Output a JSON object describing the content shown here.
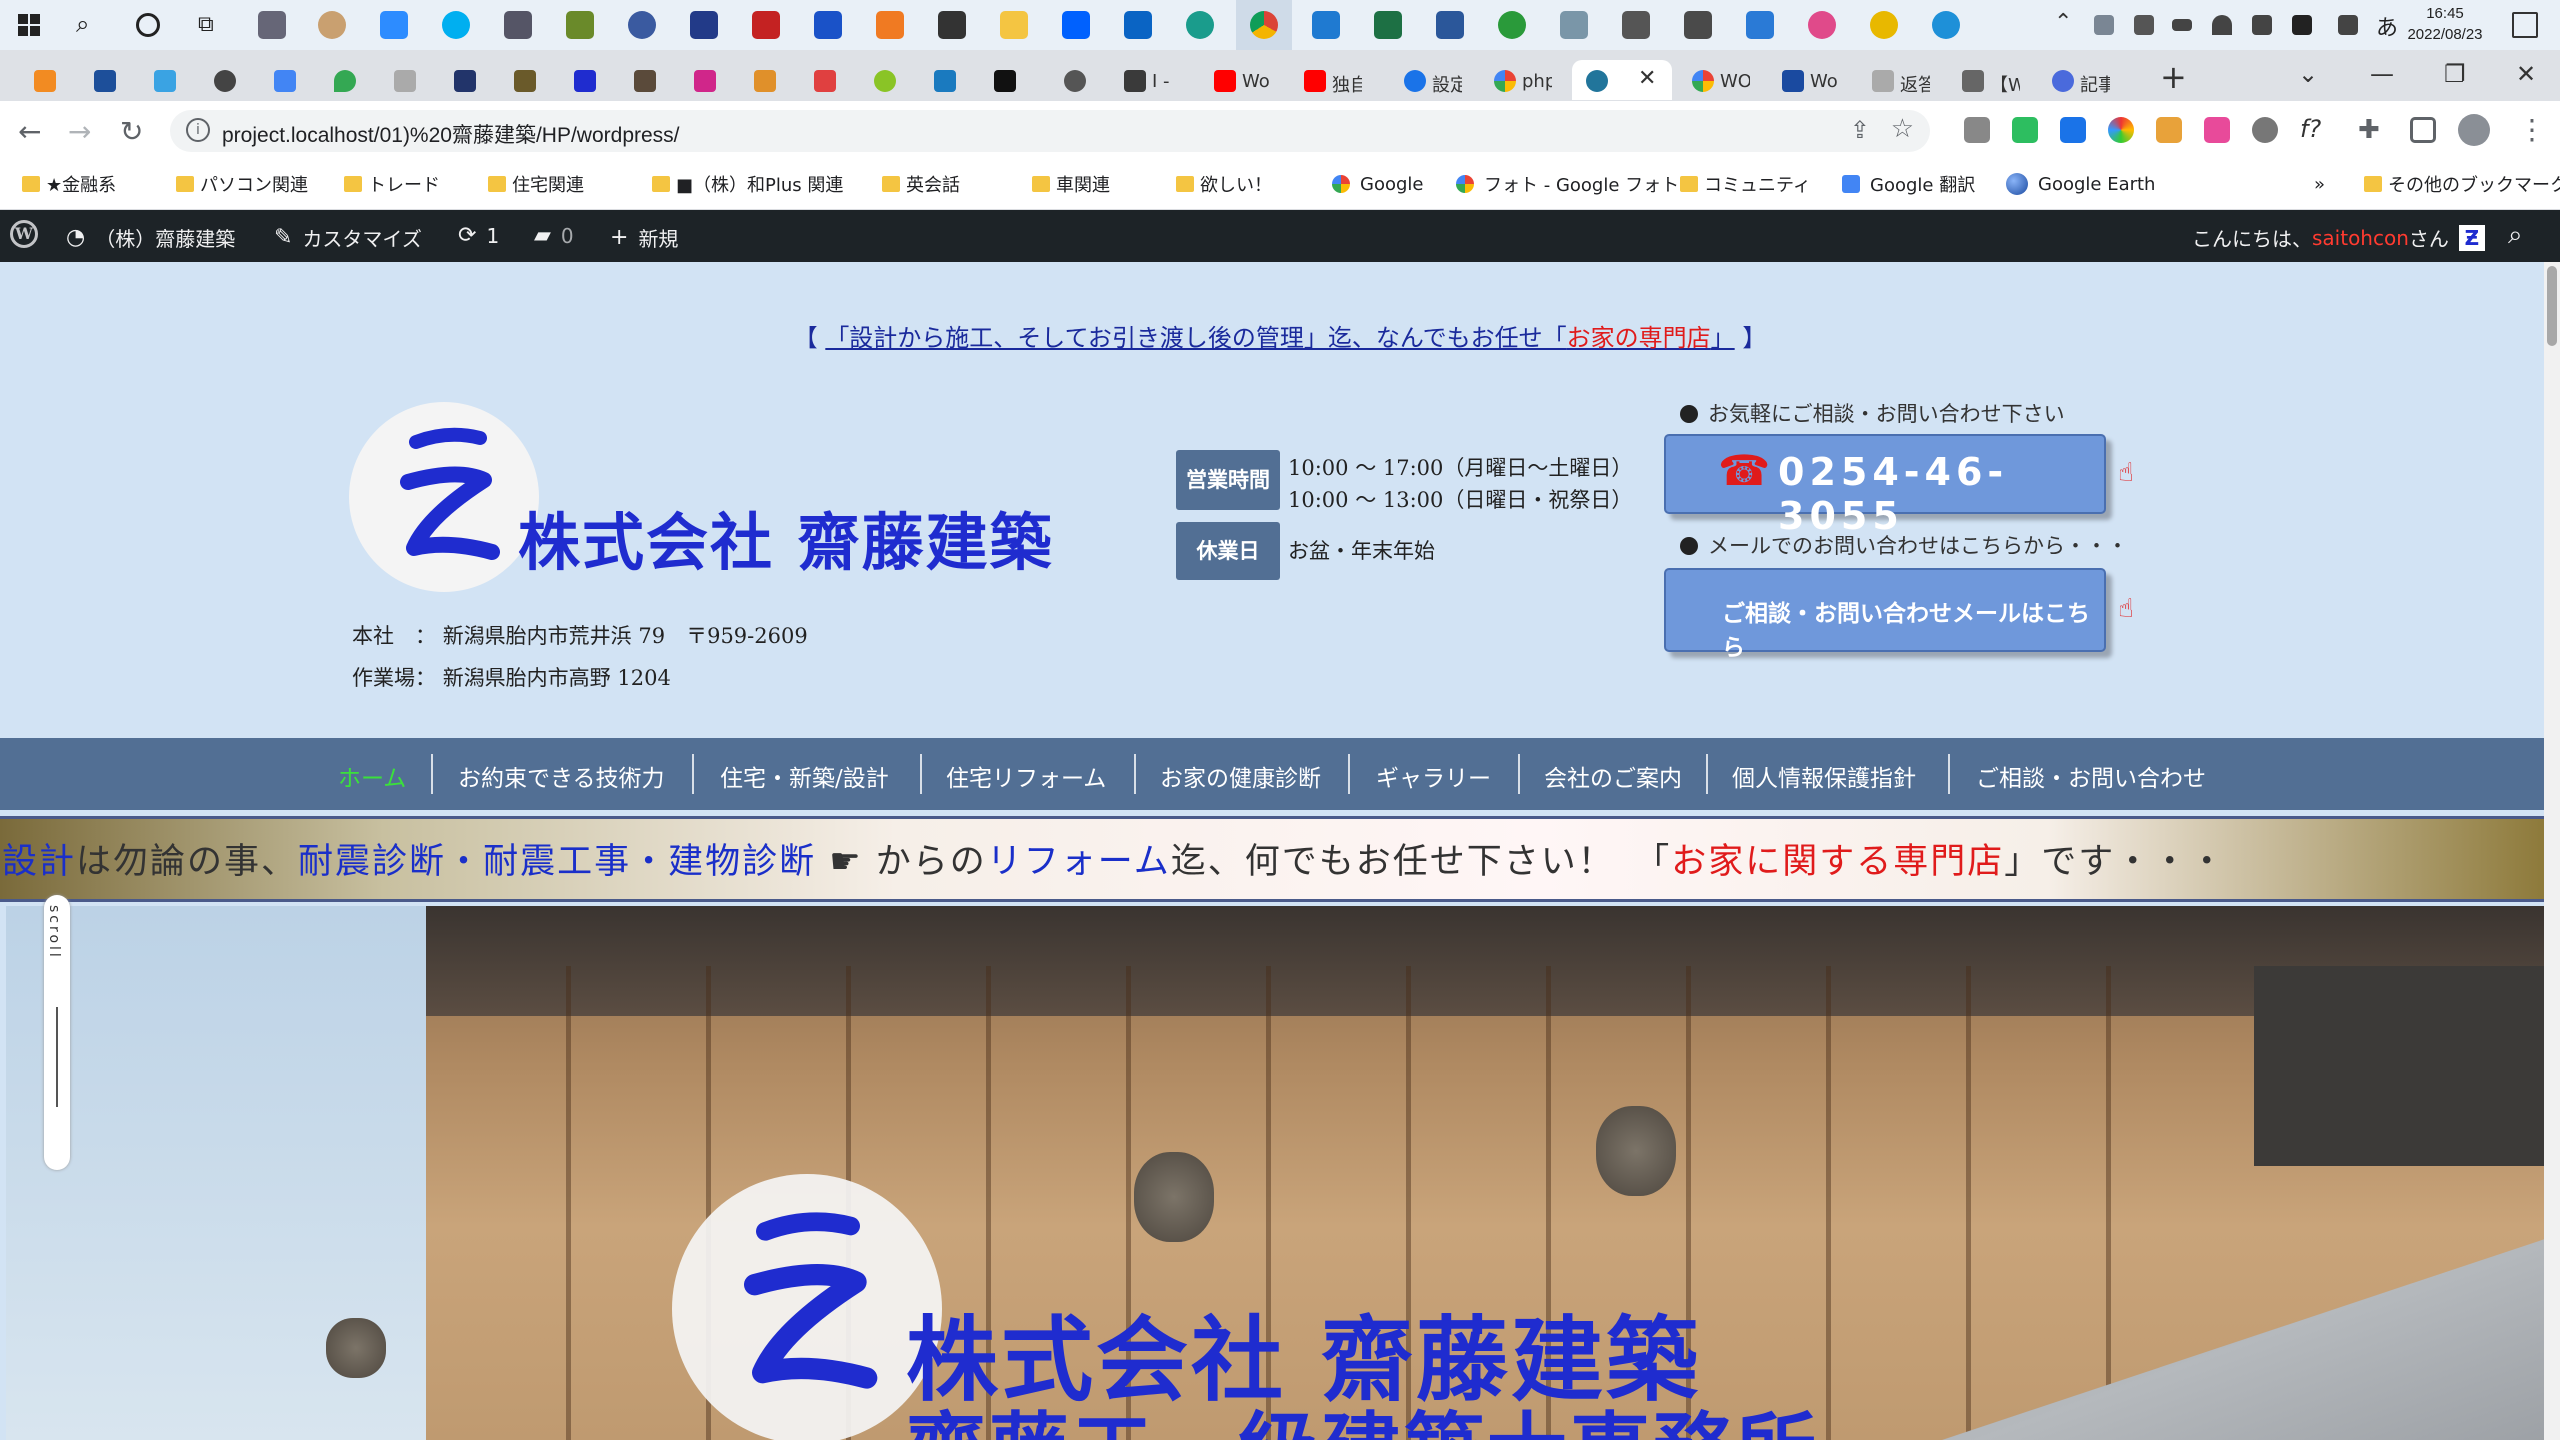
{
  "taskbar": {
    "clock_time": "16:45",
    "clock_date": "2022/08/23",
    "ime": "あ"
  },
  "browser": {
    "tabs": [
      {
        "title": "I -"
      },
      {
        "title": "Wo"
      },
      {
        "title": "独自"
      },
      {
        "title": "設定"
      },
      {
        "title": "php"
      },
      {
        "title": "",
        "active": true
      },
      {
        "title": "WO"
      },
      {
        "title": "Wo"
      },
      {
        "title": "返答"
      },
      {
        "title": "【Wo"
      },
      {
        "title": "記事"
      }
    ],
    "new_tab": "+",
    "url": "project.localhost/01)%20齋藤建築/HP/wordpress/"
  },
  "bookmarks": [
    {
      "label": "★金融系"
    },
    {
      "label": "パソコン関連"
    },
    {
      "label": "トレード"
    },
    {
      "label": "住宅関連"
    },
    {
      "label": "■（株）和Plus 関連"
    },
    {
      "label": "英会話"
    },
    {
      "label": "車関連"
    },
    {
      "label": "欲しい！"
    },
    {
      "label": "Google"
    },
    {
      "label": "フォト - Google フォト"
    },
    {
      "label": "コミュニティ"
    },
    {
      "label": "Google 翻訳"
    },
    {
      "label": "Google Earth"
    }
  ],
  "bookmarks_more": "»",
  "bookmarks_other": "その他のブックマーク",
  "adminbar": {
    "site": "（株）齋藤建築",
    "customize": "カスタマイズ",
    "updates": "1",
    "comments": "0",
    "new": "新規",
    "greeting_prefix": "こんにちは、",
    "username": "saitohcon",
    "greeting_suffix": " さん"
  },
  "header": {
    "tagline_open": "【",
    "tagline_main": "「設計から施工、そしてお引き渡し後の管理」迄、なんでもお任せ「",
    "tagline_red": "お家の専門店",
    "tagline_end": "」",
    "tagline_close": "】",
    "company_name": "株式会社 齋藤建築",
    "address_label": "本社　：",
    "address": "新潟県胎内市荒井浜 79　〒959-2609",
    "workshop_label": "作業場：",
    "workshop": "新潟県胎内市高野 1204",
    "hours_badge": "営業時間",
    "hours_line1": "10:00 ～ 17:00（月曜日～土曜日）",
    "hours_line2": "10:00 ～ 13:00（日曜日・祝祭日）",
    "holiday_badge": "休業日",
    "holiday": "お盆・年末年始",
    "contact_phone_label": "お気軽にご相談・お問い合わせ下さい",
    "phone": "0254-46-3055",
    "contact_mail_label": "メールでのお問い合わせはこちらから・・・",
    "mail_button": "ご相談・お問い合わせメールはこちら"
  },
  "nav": [
    {
      "label": "ホーム",
      "active": true
    },
    {
      "label": "お約束できる技術力"
    },
    {
      "label": "住宅・新築/設計"
    },
    {
      "label": "住宅リフォーム"
    },
    {
      "label": "お家の健康診断"
    },
    {
      "label": "ギャラリー"
    },
    {
      "label": "会社のご案内"
    },
    {
      "label": "個人情報保護指針"
    },
    {
      "label": "ご相談・お問い合わせ"
    }
  ],
  "marquee": {
    "p1": "設計",
    "p2": "は勿論の事、",
    "p3": "耐震診断",
    "p4": "・",
    "p5": "耐震工事",
    "p6": "・",
    "p7": "建物診断",
    "p8": " ☛ からの",
    "p9": "リフォーム",
    "p10": "迄、何でもお任せ下さい！　「",
    "p11": "お家に関する専門店",
    "p12": "」です・・・"
  },
  "hero": {
    "company": "株式会社 齋藤建築",
    "subtitle": "齋藤工一級建築士事務所",
    "scroll_label": "scroll"
  },
  "colors": {
    "brand_blue": "#1f2ccf",
    "nav_bg": "#526f94",
    "header_bg": "#d2e3f4",
    "button_bg": "#6f98db",
    "accent_red": "#e01b1b"
  }
}
